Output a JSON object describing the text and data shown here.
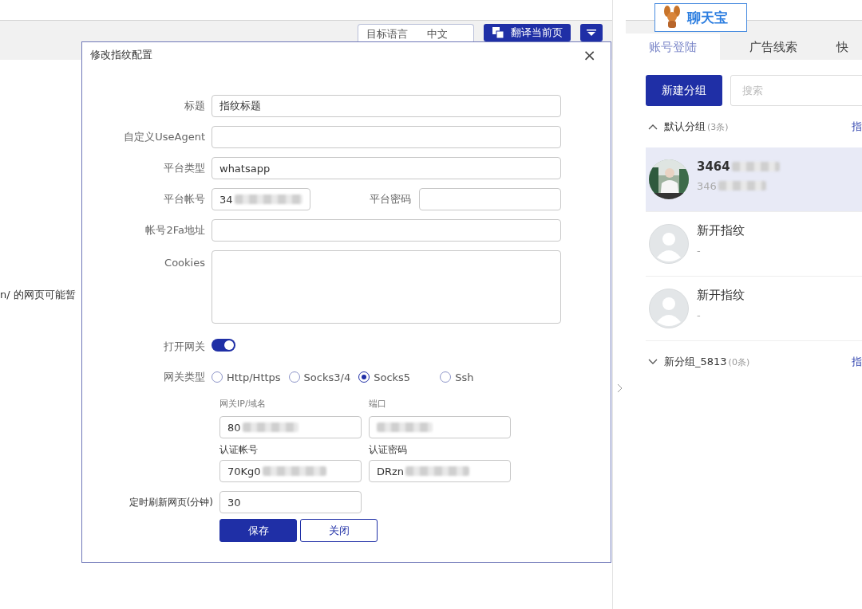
{
  "toolbar": {
    "language_label": "目标语言",
    "language_value": "中文",
    "translate_button": "翻译当前页"
  },
  "page_text": "n/ 的网页可能暂",
  "dialog": {
    "title": "修改指纹配置",
    "close": "×",
    "fields": [
      {
        "label": "标题",
        "value": "指纹标题",
        "kind": "text"
      },
      {
        "label": "自定义UseAgent",
        "kind": "text"
      },
      {
        "label": "平台类型",
        "value": "whatsapp",
        "kind": "text"
      },
      {
        "label": "平台帐号",
        "value": "34",
        "kind": "pair",
        "blurred": true,
        "second_label": "平台密码"
      },
      {
        "label": "帐号2Fa地址",
        "kind": "text"
      },
      {
        "label": "Cookies",
        "kind": "area"
      }
    ],
    "gateway_switch": {
      "label": "打开网关",
      "on": true
    },
    "gateway_type": {
      "label": "网关类型",
      "options": [
        {
          "label": "Http/Https",
          "selected": false
        },
        {
          "label": "Socks3/4",
          "selected": false
        },
        {
          "label": "Socks5",
          "selected": true
        },
        {
          "label": "Ssh",
          "selected": false
        }
      ]
    },
    "proxy_fields": [
      {
        "label": "网关IP/域名",
        "value": "80",
        "blurred": true
      },
      {
        "label": "端口",
        "blurred": true
      },
      {
        "label": "认证帐号",
        "value": "70Kg0",
        "blurred": true
      },
      {
        "label": "认证密码",
        "value": "DRzn",
        "blurred": true
      }
    ],
    "refresh": {
      "label": "定时刷新网页(分钟)",
      "value": "30"
    },
    "buttons": [
      {
        "label": "保存",
        "kind": "primary"
      },
      {
        "label": "关闭",
        "kind": "secondary"
      }
    ]
  },
  "logo": {
    "text": "聊天宝"
  },
  "side_panel": {
    "tabs": [
      {
        "label": "账号登陆",
        "selected": true
      },
      {
        "label": "广告线索",
        "selected": false
      },
      {
        "label": "快",
        "selected": false
      }
    ],
    "new_group_button": "新建分组",
    "search": {
      "placeholder": "搜索"
    },
    "groups": [
      {
        "name": "默认分组",
        "count": "(3条)",
        "action": "指",
        "expanded": true,
        "items": [
          {
            "title": "3464",
            "subtitle": "346",
            "blurred": true,
            "has_photo": true,
            "selected": true
          },
          {
            "title": "新开指纹",
            "subtitle": "-",
            "blurred": false,
            "has_photo": false,
            "selected": false
          },
          {
            "title": "新开指纹",
            "subtitle": "-",
            "blurred": false,
            "has_photo": false,
            "selected": false
          }
        ]
      },
      {
        "name": "新分组_5813",
        "count": "(0条)",
        "action": "指",
        "expanded": false
      }
    ]
  }
}
